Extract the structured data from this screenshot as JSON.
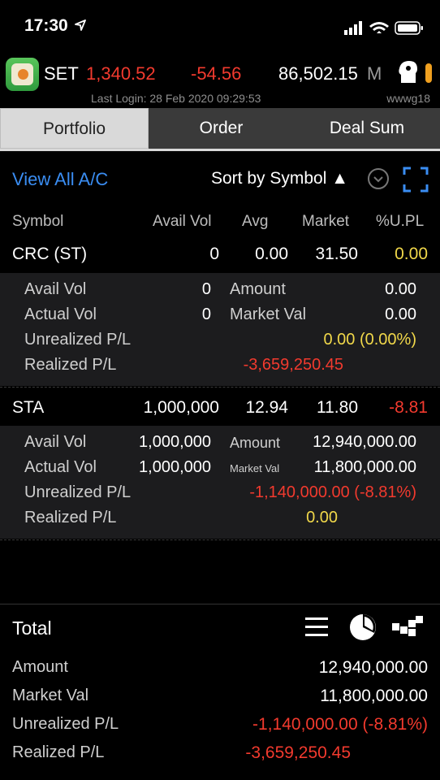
{
  "status_bar": {
    "time": "17:30"
  },
  "index_bar": {
    "market": "SET",
    "value": "1,340.52",
    "change": "-54.56",
    "volume": "86,502.15",
    "volume_unit": "M",
    "last_login": "Last Login: 28 Feb 2020 09:29:53",
    "user_id": "wwwg18"
  },
  "tabs": [
    {
      "label": "Portfolio",
      "active": true
    },
    {
      "label": "Order",
      "active": false
    },
    {
      "label": "Deal Sum",
      "active": false
    }
  ],
  "toolbar": {
    "view_all": "View All A/C",
    "sort_label": "Sort by Symbol ▲"
  },
  "columns": [
    "Symbol",
    "Avail Vol",
    "Avg",
    "Market",
    "%U.PL"
  ],
  "holdings": [
    {
      "symbol": "CRC (ST)",
      "avail_vol": "0",
      "avg": "0.00",
      "market": "31.50",
      "upl_pct": "0.00",
      "details": {
        "avail_vol_label": "Avail Vol",
        "avail_vol": "0",
        "actual_vol_label": "Actual Vol",
        "actual_vol": "0",
        "amount_label": "Amount",
        "amount": "0.00",
        "market_val_label": "Market Val",
        "market_val": "0.00",
        "unrealized_label": "Unrealized P/L",
        "unrealized": "0.00 (0.00%)",
        "realized_label": "Realized P/L",
        "realized": "-3,659,250.45"
      }
    },
    {
      "symbol": "STA",
      "avail_vol": "1,000,000",
      "avg": "12.94",
      "market": "11.80",
      "upl_pct": "-8.81",
      "details": {
        "avail_vol_label": "Avail Vol",
        "avail_vol": "1,000,000",
        "actual_vol_label": "Actual Vol",
        "actual_vol": "1,000,000",
        "amount_label": "Amount",
        "amount": "12,940,000.00",
        "market_val_label": "Market Val",
        "market_val": "11,800,000.00",
        "unrealized_label": "Unrealized P/L",
        "unrealized": "-1,140,000.00 (-8.81%)",
        "realized_label": "Realized P/L",
        "realized": "0.00"
      }
    }
  ],
  "total": {
    "title": "Total",
    "amount_label": "Amount",
    "amount": "12,940,000.00",
    "market_val_label": "Market Val",
    "market_val": "11,800,000.00",
    "unrealized_label": "Unrealized P/L",
    "unrealized": "-1,140,000.00 (-8.81%)",
    "realized_label": "Realized P/L",
    "realized": "-3,659,250.45"
  },
  "colors": {
    "up_down_red": "#f23a2e",
    "neutral_yellow": "#f1d84a",
    "link_blue": "#3a8df2"
  },
  "icons": [
    "location-arrow-icon",
    "signal-icon",
    "wifi-icon",
    "battery-icon",
    "app-logo",
    "profile-head-icon",
    "chevron-down-icon",
    "expand-icon",
    "list-icon",
    "pie-chart-icon",
    "tiles-icon"
  ]
}
